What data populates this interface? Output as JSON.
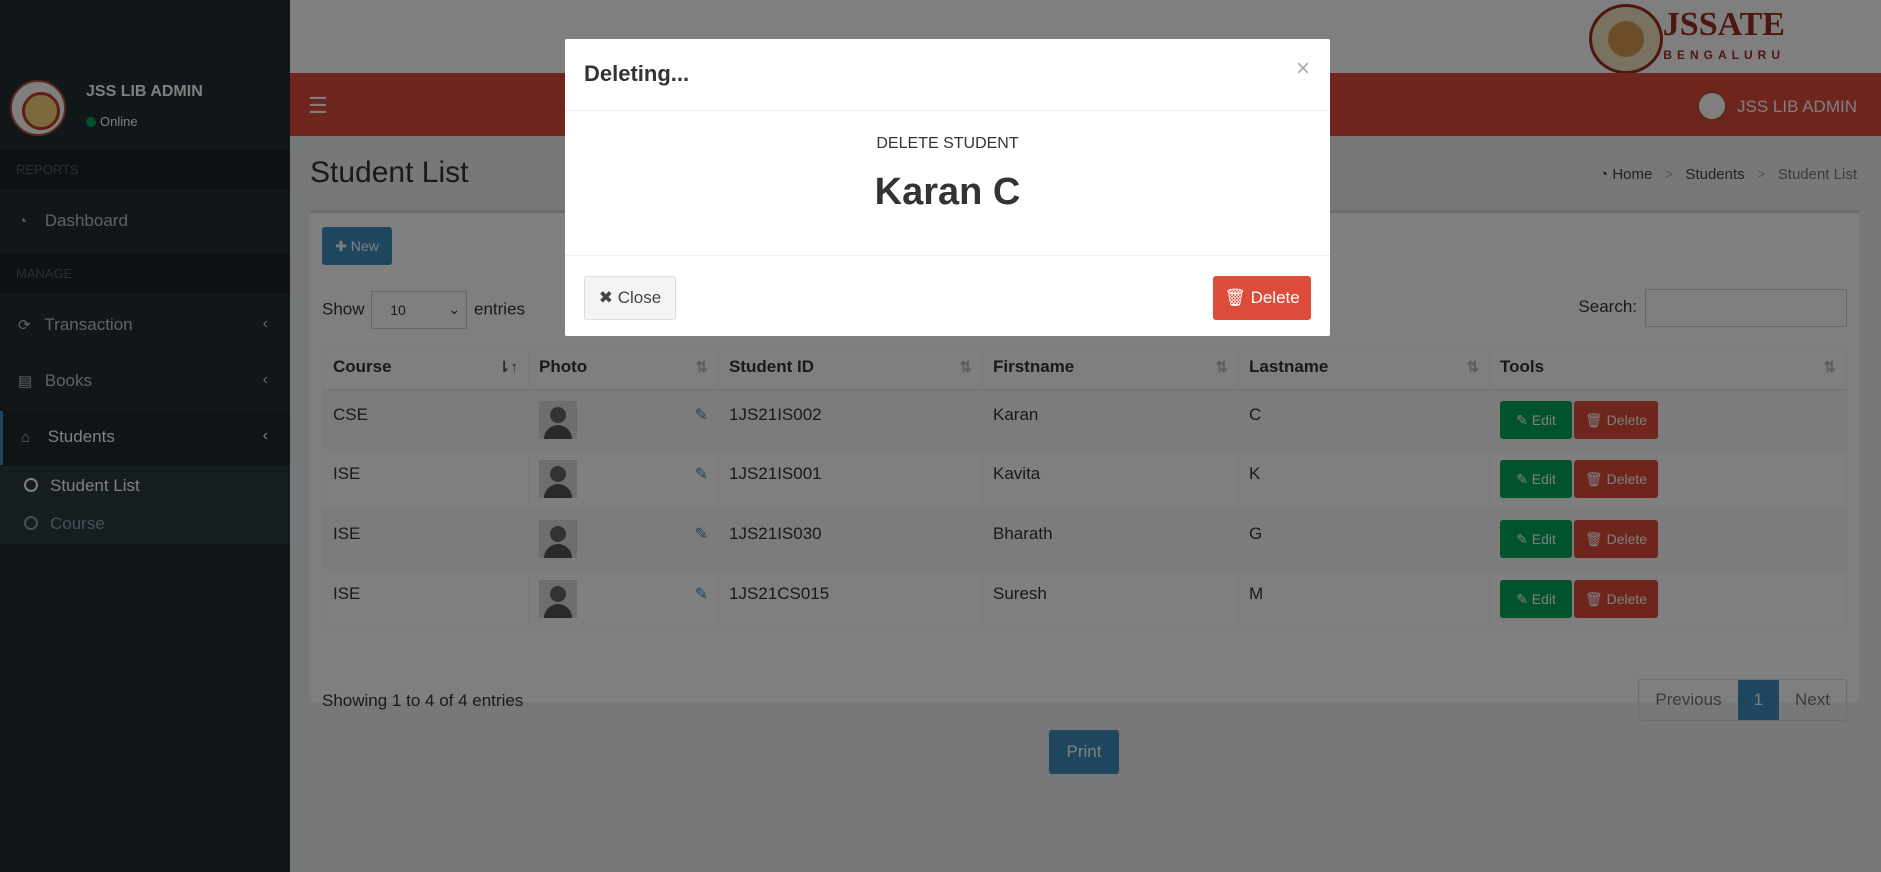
{
  "sidebar": {
    "user_name": "JSS LIB ADMIN",
    "status": "Online",
    "headers": [
      "REPORTS",
      "MANAGE"
    ],
    "items": [
      {
        "label": "Dashboard",
        "icon": "dashboard-icon"
      },
      {
        "label": "Transaction",
        "icon": "refresh-icon"
      },
      {
        "label": "Books",
        "icon": "book-icon"
      },
      {
        "label": "Students",
        "icon": "graduation-cap-icon"
      }
    ],
    "sub_items": [
      {
        "label": "Student List"
      },
      {
        "label": "Course"
      }
    ]
  },
  "brand": {
    "name": "JSSATE",
    "city": "BENGALURU"
  },
  "navbar": {
    "user_name": "JSS LIB ADMIN"
  },
  "page": {
    "title": "Student List",
    "breadcrumb": [
      "Home",
      "Students",
      "Student List"
    ]
  },
  "toolbar": {
    "new_label": "New",
    "show_label": "Show",
    "entries_value": "10",
    "entries_label": "entries",
    "search_label": "Search:"
  },
  "table": {
    "headers": [
      "Course",
      "Photo",
      "Student ID",
      "Firstname",
      "Lastname",
      "Tools"
    ],
    "rows": [
      {
        "course": "CSE",
        "student_id": "1JS21IS002",
        "firstname": "Karan",
        "lastname": "C"
      },
      {
        "course": "ISE",
        "student_id": "1JS21IS001",
        "firstname": "Kavita",
        "lastname": "K"
      },
      {
        "course": "ISE",
        "student_id": "1JS21IS030",
        "firstname": "Bharath",
        "lastname": "G"
      },
      {
        "course": "ISE",
        "student_id": "1JS21CS015",
        "firstname": "Suresh",
        "lastname": "M"
      }
    ],
    "edit_label": "Edit",
    "delete_label": "Delete"
  },
  "footer": {
    "info": "Showing 1 to 4 of 4 entries",
    "previous": "Previous",
    "current_page": "1",
    "next": "Next",
    "print": "Print"
  },
  "modal": {
    "title": "Deleting...",
    "close_x": "×",
    "subtitle": "DELETE STUDENT",
    "name": "Karan C",
    "close_label": "Close",
    "delete_label": "Delete"
  },
  "colors": {
    "navbar": "#dd4b39",
    "sidebar": "#222d32",
    "primary": "#3c8dbc",
    "success": "#00a65a",
    "danger": "#dd4b39"
  }
}
